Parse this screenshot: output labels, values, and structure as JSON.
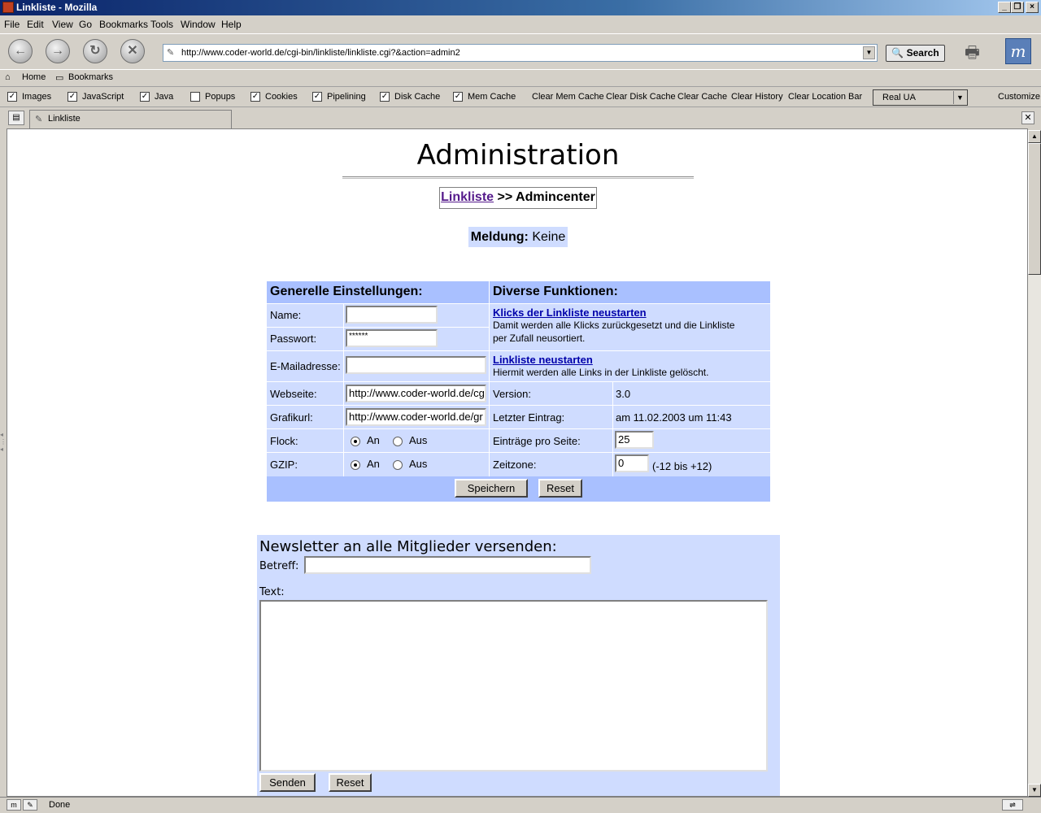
{
  "window": {
    "title": "Linkliste - Mozilla"
  },
  "menu": [
    "File",
    "Edit",
    "View",
    "Go",
    "Bookmarks",
    "Tools",
    "Window",
    "Help"
  ],
  "nav": {
    "url": "http://www.coder-world.de/cgi-bin/linkliste/linkliste.cgi?&action=admin2",
    "search_label": "Search"
  },
  "personal": {
    "home": "Home",
    "bookmarks": "Bookmarks"
  },
  "prefbar": {
    "checks": [
      {
        "label": "Images",
        "checked": true
      },
      {
        "label": "JavaScript",
        "checked": true
      },
      {
        "label": "Java",
        "checked": true
      },
      {
        "label": "Popups",
        "checked": false
      },
      {
        "label": "Cookies",
        "checked": true
      },
      {
        "label": "Pipelining",
        "checked": true
      },
      {
        "label": "Disk Cache",
        "checked": true
      },
      {
        "label": "Mem Cache",
        "checked": true
      }
    ],
    "clear": [
      "Clear Mem Cache",
      "Clear Disk Cache",
      "Clear Cache",
      "Clear History",
      "Clear Location Bar"
    ],
    "ua": "Real UA",
    "customize": "Customize"
  },
  "tab": {
    "label": "Linkliste"
  },
  "page": {
    "title": "Administration",
    "crumb_link": "Linkliste",
    "crumb_rest": ">> Admincenter",
    "meldung_label": "Meldung:",
    "meldung_value": "Keine"
  },
  "settings": {
    "left_header": "Generelle Einstellungen:",
    "right_header": "Diverse Funktionen:",
    "name_label": "Name:",
    "name_value": "",
    "pass_label": "Passwort:",
    "pass_value": "******",
    "email_label": "E-Mailadresse:",
    "email_value": "",
    "web_label": "Webseite:",
    "web_value": "http://www.coder-world.de/cg",
    "graf_label": "Grafikurl:",
    "graf_value": "http://www.coder-world.de/gr",
    "flock_label": "Flock:",
    "gzip_label": "GZIP:",
    "an": "An",
    "aus": "Aus",
    "reset_clicks_link": "Klicks der Linkliste neustarten",
    "reset_clicks_desc1": "Damit werden alle Klicks zurückgesetzt und die Linkliste",
    "reset_clicks_desc2": "per Zufall neusortiert.",
    "reset_list_link": "Linkliste neustarten",
    "reset_list_desc": "Hiermit werden alle Links in der Linkliste gelöscht.",
    "version_label": "Version:",
    "version_value": "3.0",
    "last_label": "Letzter Eintrag:",
    "last_value": "am 11.02.2003 um 11:43",
    "per_page_label": "Einträge pro Seite:",
    "per_page_value": "25",
    "tz_label": "Zeitzone:",
    "tz_value": "0",
    "tz_hint": "(-12 bis +12)",
    "save": "Speichern",
    "reset": "Reset"
  },
  "newsletter": {
    "heading": "Newsletter an alle Mitglieder versenden:",
    "subject_label": "Betreff:",
    "subject_value": "",
    "text_label": "Text:",
    "send": "Senden",
    "reset": "Reset"
  },
  "status": {
    "text": "Done"
  },
  "colors": {
    "table_bg": "#cfdcff",
    "header_bg": "#a9c0ff",
    "link": "#0000aa",
    "visited": "#551a8b"
  }
}
